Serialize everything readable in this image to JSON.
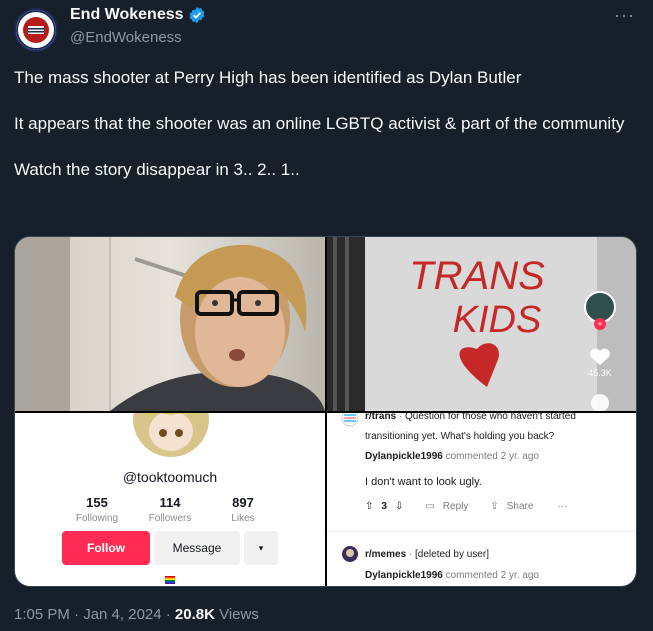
{
  "author": {
    "name": "End Wokeness",
    "handle": "@EndWokeness",
    "avatar_text": "FIGHT THE WOKE",
    "verified_color": "#1d9bf0"
  },
  "menu_icon": "more-horizontal-icon",
  "tweet": {
    "paragraphs": [
      "The mass shooter at Perry High has been identified as Dylan Butler",
      "It appears that the shooter was an online LGBTQ activist & part of the community",
      "Watch the story disappear in 3.. 2.. 1.."
    ]
  },
  "media": {
    "wall_text_line1": "TRANS",
    "wall_text_line2": "KIDS",
    "tiktok_side": {
      "likes": "45.3K"
    },
    "tiktok_profile": {
      "handle": "@tooktoomuch",
      "stats": [
        {
          "value": "155",
          "label": "Following"
        },
        {
          "value": "114",
          "label": "Followers"
        },
        {
          "value": "897",
          "label": "Likes"
        }
      ],
      "follow_label": "Follow",
      "message_label": "Message",
      "dropdown_icon": "▾"
    },
    "reddit": {
      "post1": {
        "subreddit": "r/trans",
        "title_line1": "Question for those who haven't started",
        "title_line2": "transitioning yet. What's holding you back?",
        "user": "Dylanpickle1996",
        "meta": "commented 2 yr. ago",
        "comment": "I don't want to look ugly.",
        "votes": "3",
        "reply_label": "Reply",
        "share_label": "Share",
        "more": "···"
      },
      "post2": {
        "subreddit": "r/memes",
        "title": "[deleted by user]",
        "user": "Dylanpickle1996",
        "meta": "commented 2 yr. ago"
      }
    }
  },
  "footer": {
    "time": "1:05 PM · Jan 4, 2024 · ",
    "views_count": "20.8K",
    "views_label": " Views"
  },
  "colors": {
    "background": "#15202b",
    "text": "#f7f9f9",
    "muted": "#8b98a5",
    "tiktok_red": "#fe2c55"
  }
}
